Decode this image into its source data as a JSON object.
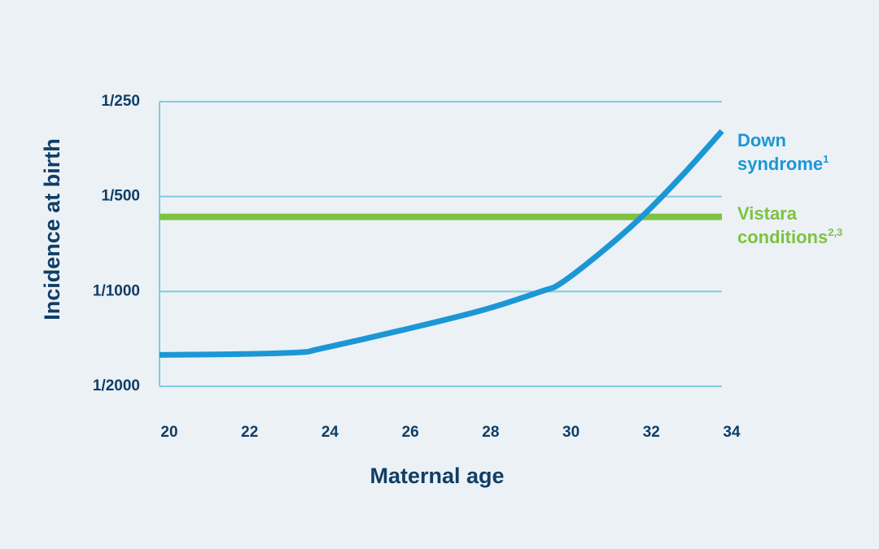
{
  "chart_data": {
    "type": "line",
    "title": "",
    "xlabel": "Maternal age",
    "ylabel": "Incidence at birth",
    "x_ticks": [
      20,
      22,
      24,
      26,
      28,
      30,
      32,
      34
    ],
    "x_tick_labels": [
      "20",
      "22",
      "24",
      "26",
      "28",
      "30",
      "32",
      "34"
    ],
    "xlim": [
      20,
      34
    ],
    "y_scale": "log (denominator)",
    "y_ticks": [
      250,
      500,
      1000,
      2000
    ],
    "y_tick_labels": [
      "1/250",
      "1/500",
      "1/1000",
      "1/2000"
    ],
    "ylim_denominator": [
      2000,
      250
    ],
    "grid": "horizontal",
    "series": [
      {
        "name": "Down syndrome",
        "superscript": "1",
        "color": "#1b97d5",
        "x": [
          20,
          22,
          23.5,
          24,
          26,
          28,
          29.5,
          30,
          31,
          32,
          33,
          34
        ],
        "y_denominator": [
          1590,
          1580,
          1560,
          1520,
          1330,
          1150,
          1000,
          940,
          750,
          580,
          430,
          310
        ]
      },
      {
        "name": "Vistara conditions",
        "superscript": "2,3",
        "color": "#7dc242",
        "x": [
          20,
          34
        ],
        "y_denominator": [
          580,
          580
        ]
      }
    ],
    "legend": "right, inline labels at line ends"
  },
  "colors": {
    "background": "#ecf1f6",
    "gridline": "#7fcbe0",
    "text": "#0f3e66"
  }
}
